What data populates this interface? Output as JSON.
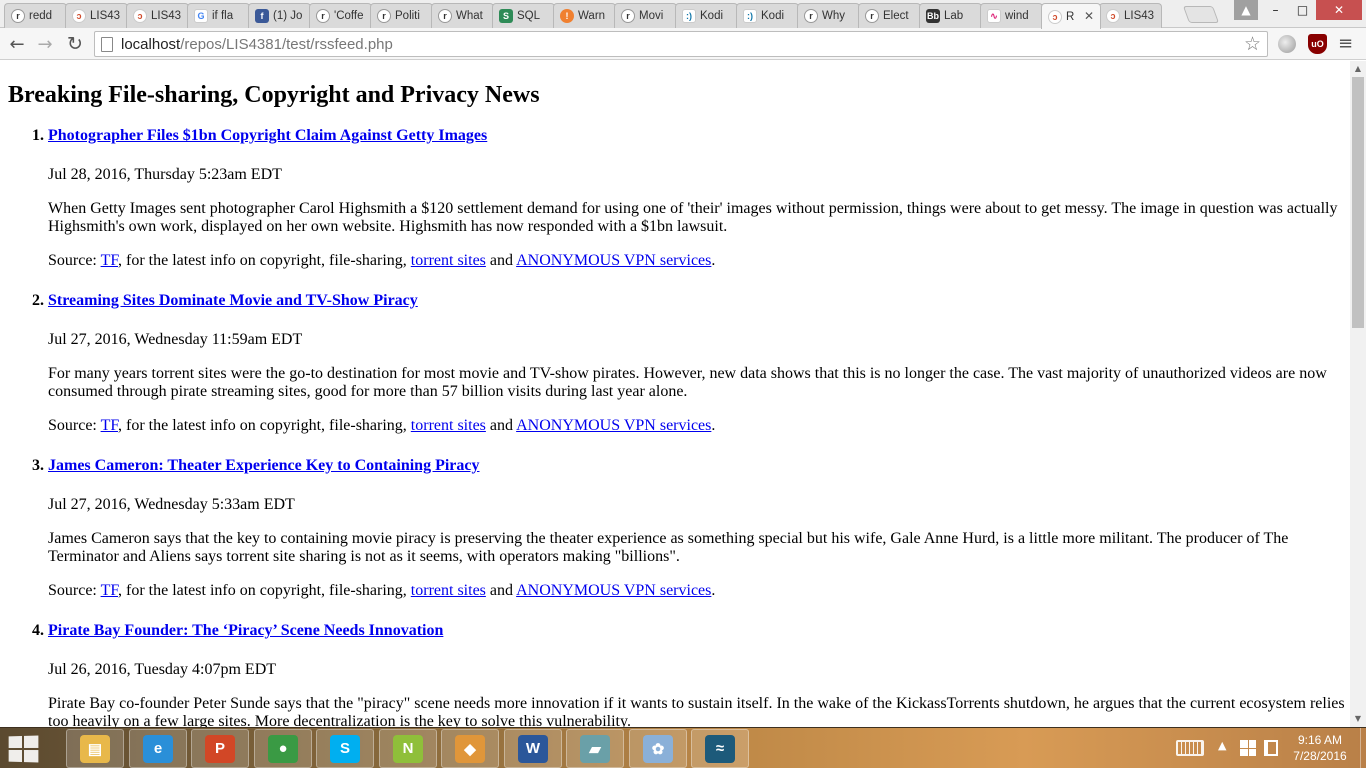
{
  "browser": {
    "tabs": [
      {
        "label": "redd",
        "icon": "reddit-icon"
      },
      {
        "label": "LIS43",
        "icon": "lis-icon"
      },
      {
        "label": "LIS43",
        "icon": "lis-icon"
      },
      {
        "label": "if fla",
        "icon": "google-icon"
      },
      {
        "label": "(1) Jo",
        "icon": "facebook-icon"
      },
      {
        "label": "'Coffe",
        "icon": "reddit-icon"
      },
      {
        "label": "Politi",
        "icon": "reddit-icon"
      },
      {
        "label": "What",
        "icon": "reddit-icon"
      },
      {
        "label": "SQL",
        "icon": "sql-icon"
      },
      {
        "label": "Warn",
        "icon": "warning-icon"
      },
      {
        "label": "Movi",
        "icon": "reddit-icon"
      },
      {
        "label": "Kodi",
        "icon": "kodi-icon"
      },
      {
        "label": "Kodi",
        "icon": "kodi-icon"
      },
      {
        "label": "Why",
        "icon": "reddit-icon"
      },
      {
        "label": "Elect",
        "icon": "reddit-icon"
      },
      {
        "label": "Lab",
        "icon": "blackboard-icon"
      },
      {
        "label": "wind",
        "icon": "wind-icon"
      },
      {
        "label": "R",
        "icon": "lis-icon",
        "active": true
      },
      {
        "label": "LIS43",
        "icon": "lis-icon"
      }
    ],
    "favicon_text": {
      "reddit-icon": "r",
      "lis-icon": "ɔ",
      "google-icon": "G",
      "facebook-icon": "f",
      "sql-icon": "S",
      "warning-icon": "!",
      "kodi-icon": ":)",
      "blackboard-icon": "Bb",
      "wind-icon": "∿"
    },
    "url_host": "localhost",
    "url_path": "/repos/LIS4381/test/rssfeed.php",
    "glyphs": {
      "back": "←",
      "forward": "→",
      "reload": "↻",
      "star": "☆",
      "menu": "≡",
      "close_tab": "✕",
      "minimize": "–",
      "maximize": "□",
      "close_window": "✕",
      "profile": "▲",
      "ublock": "uO",
      "scroll_up": "▲",
      "scroll_down": "▼"
    }
  },
  "page": {
    "title": "Breaking File-sharing, Copyright and Privacy News",
    "items": [
      {
        "num": "1.",
        "title": "Photographer Files $1bn Copyright Claim Against Getty Images",
        "date": "Jul 28, 2016, Thursday 5:23am EDT",
        "description": "When Getty Images sent photographer Carol Highsmith a $120 settlement demand for using one of 'their' images without permission, things were about to get messy. The image in question was actually Highsmith's own work, displayed on her own website. Highsmith has now responded with a $1bn lawsuit."
      },
      {
        "num": "2.",
        "title": "Streaming Sites Dominate Movie and TV-Show Piracy",
        "date": "Jul 27, 2016, Wednesday 11:59am EDT",
        "description": "For many years torrent sites were the go-to destination for most movie and TV-show pirates. However, new data shows that this is no longer the case. The vast majority of unauthorized videos are now consumed through pirate streaming sites, good for more than 57 billion visits during last year alone."
      },
      {
        "num": "3.",
        "title": "James Cameron: Theater Experience Key to Containing Piracy",
        "date": "Jul 27, 2016, Wednesday 5:33am EDT",
        "description": "James Cameron says that the key to containing movie piracy is preserving the theater experience as something special but his wife, Gale Anne Hurd, is a little more militant. The producer of The Terminator and Aliens says torrent site sharing is not as it seems, with operators making \"billions\"."
      },
      {
        "num": "4.",
        "title": "Pirate Bay Founder: The ‘Piracy’ Scene Needs Innovation",
        "date": "Jul 26, 2016, Tuesday 4:07pm EDT",
        "description": "Pirate Bay co-founder Peter Sunde says that the \"piracy\" scene needs more innovation if it wants to sustain itself. In the wake of the KickassTorrents shutdown, he argues that the current ecosystem relies too heavily on a few large sites. More decentralization is the key to solve this vulnerability."
      }
    ],
    "source": {
      "prefix": "Source: ",
      "tf_link": "TF",
      "middle": ", for the latest info on copyright, file-sharing, ",
      "torrent_link": "torrent sites",
      "and": " and ",
      "vpn_link": "ANONYMOUS VPN services",
      "suffix": "."
    }
  },
  "taskbar": {
    "apps": [
      {
        "name": "file-explorer-icon",
        "glyph": "▤",
        "color": "#e8b84a"
      },
      {
        "name": "internet-explorer-icon",
        "glyph": "e",
        "color": "#2a8fd8"
      },
      {
        "name": "powerpoint-icon",
        "glyph": "P",
        "color": "#d24726"
      },
      {
        "name": "chrome-icon",
        "glyph": "●",
        "color": "#3a9a44"
      },
      {
        "name": "skype-icon",
        "glyph": "S",
        "color": "#00aff0"
      },
      {
        "name": "notepad-plus-icon",
        "glyph": "N",
        "color": "#8fbf3a"
      },
      {
        "name": "git-icon",
        "glyph": "◆",
        "color": "#e0963a"
      },
      {
        "name": "word-icon",
        "glyph": "W",
        "color": "#2b579a"
      },
      {
        "name": "sticky-app-icon",
        "glyph": "▰",
        "color": "#6aa0a8"
      },
      {
        "name": "paint-icon",
        "glyph": "✿",
        "color": "#8ab0d8"
      },
      {
        "name": "mysql-workbench-icon",
        "glyph": "≈",
        "color": "#1d5a7a"
      }
    ],
    "time": "9:16 AM",
    "date": "7/28/2016",
    "tray_arrow": "▲"
  }
}
